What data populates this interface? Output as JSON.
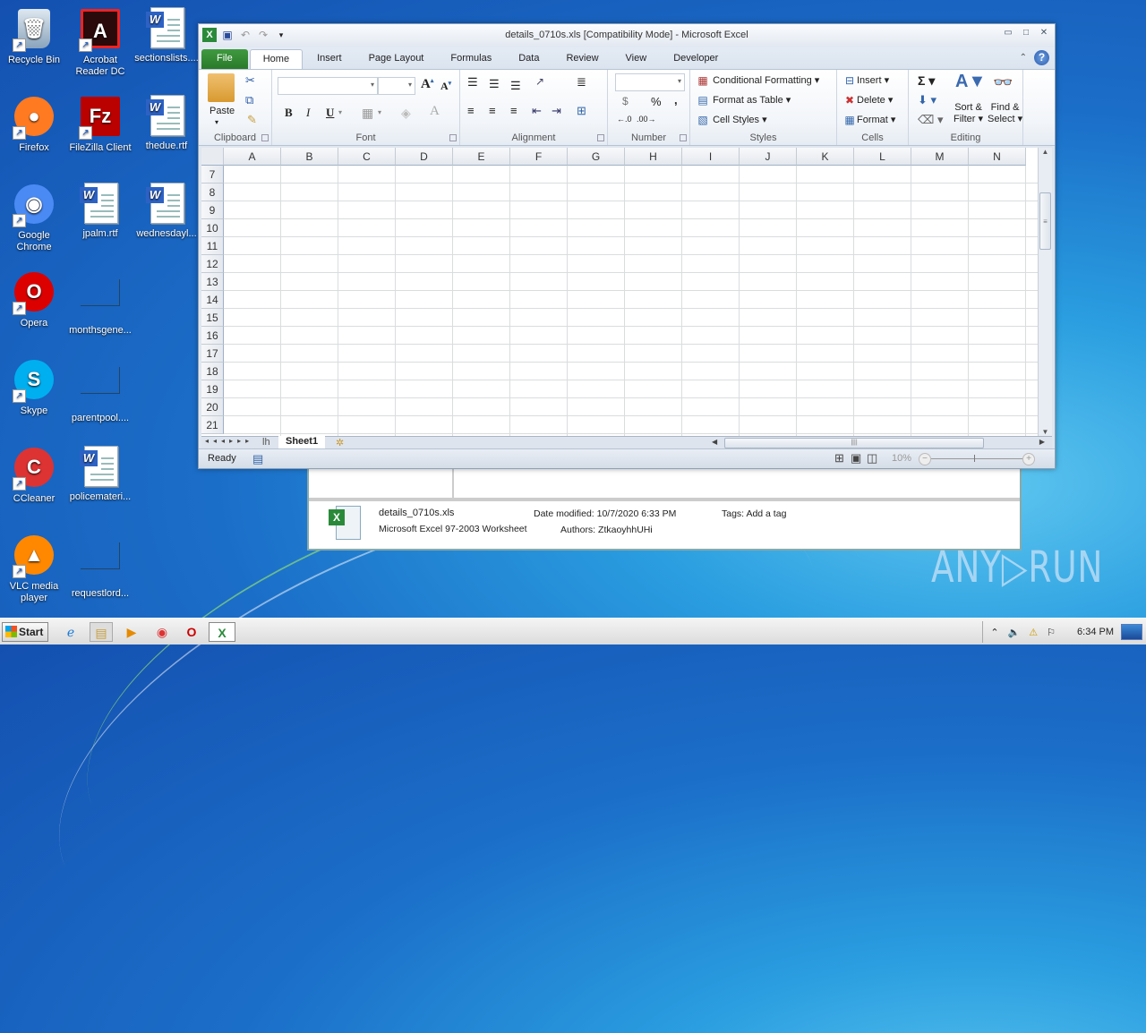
{
  "desktop": {
    "icons": [
      {
        "label": "Recycle Bin",
        "icon": "recycle-bin-icon"
      },
      {
        "label": "Acrobat Reader DC",
        "icon": "acrobat-icon"
      },
      {
        "label": "sectionslists....",
        "icon": "word-doc-icon"
      },
      {
        "label": "Firefox",
        "icon": "firefox-icon"
      },
      {
        "label": "FileZilla Client",
        "icon": "filezilla-icon"
      },
      {
        "label": "thedue.rtf",
        "icon": "word-doc-icon"
      },
      {
        "label": "Google Chrome",
        "icon": "chrome-icon"
      },
      {
        "label": "jpalm.rtf",
        "icon": "word-doc-icon"
      },
      {
        "label": "wednesdayl...",
        "icon": "word-doc-icon"
      },
      {
        "label": "Opera",
        "icon": "opera-icon"
      },
      {
        "label": "monthsgene...",
        "icon": "blank-file-icon"
      },
      {
        "label": "Skype",
        "icon": "skype-icon"
      },
      {
        "label": "parentpool....",
        "icon": "blank-file-icon"
      },
      {
        "label": "CCleaner",
        "icon": "ccleaner-icon"
      },
      {
        "label": "policemateri...",
        "icon": "word-doc-icon"
      },
      {
        "label": "VLC media player",
        "icon": "vlc-icon"
      },
      {
        "label": "requestlord...",
        "icon": "blank-file-icon"
      }
    ]
  },
  "excel": {
    "title": "details_0710s.xls  [Compatibility Mode]  -  Microsoft Excel",
    "tabs": [
      "File",
      "Home",
      "Insert",
      "Page Layout",
      "Formulas",
      "Data",
      "Review",
      "View",
      "Developer"
    ],
    "active_tab": "Home",
    "ribbon": {
      "clipboard": {
        "label": "Clipboard",
        "paste": "Paste"
      },
      "font": {
        "label": "Font",
        "font_name": "",
        "font_size": "",
        "bold": "B",
        "italic": "I",
        "underline": "U"
      },
      "alignment": {
        "label": "Alignment"
      },
      "number": {
        "label": "Number",
        "format": "",
        "currency": "$",
        "percent": "%",
        "comma": ","
      },
      "styles": {
        "label": "Styles",
        "conditional": "Conditional Formatting",
        "format_table": "Format as Table",
        "cell_styles": "Cell Styles"
      },
      "cells": {
        "label": "Cells",
        "insert": "Insert",
        "delete": "Delete",
        "format": "Format"
      },
      "editing": {
        "label": "Editing",
        "sort": "Sort &",
        "sort2": "Filter",
        "find": "Find &",
        "find2": "Select"
      }
    },
    "columns": [
      "A",
      "B",
      "C",
      "D",
      "E",
      "F",
      "G",
      "H",
      "I",
      "J",
      "K",
      "L",
      "M",
      "N"
    ],
    "rows": [
      "7",
      "8",
      "9",
      "10",
      "11",
      "12",
      "13",
      "14",
      "15",
      "16",
      "17",
      "18",
      "19",
      "20",
      "21"
    ],
    "sheets": [
      "lh",
      "Sheet1"
    ],
    "active_sheet": "Sheet1",
    "status": "Ready",
    "zoom": "10%"
  },
  "explorer": {
    "filename": "details_0710s.xls",
    "filetype": "Microsoft Excel 97-2003 Worksheet",
    "date_label": "Date modified:",
    "date_value": "10/7/2020 6:33 PM",
    "authors_label": "Authors:",
    "authors_value": "ZtkaoyhhUHi",
    "tags_label": "Tags:",
    "tags_value": "Add a tag"
  },
  "taskbar": {
    "start": "Start",
    "clock": "6:34 PM"
  },
  "watermark": "ANY▷RUN"
}
